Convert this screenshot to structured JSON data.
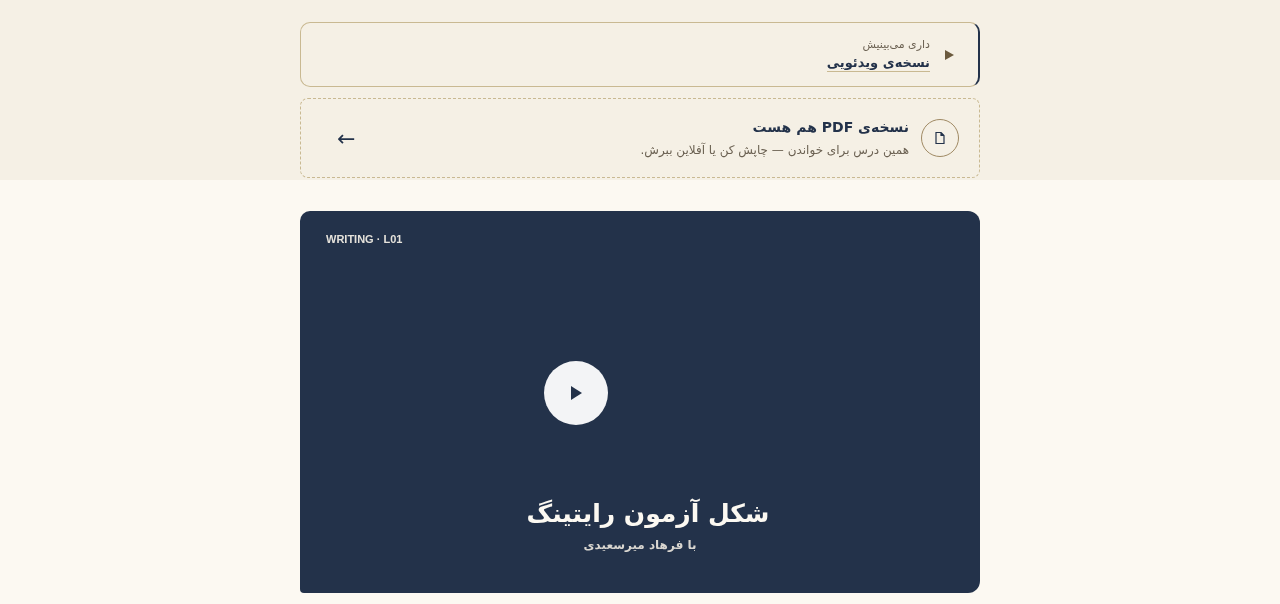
{
  "now_watching": {
    "caption": "داری می‌بینیش",
    "title": "نسخه‌ی ویدئویی",
    "selected": true
  },
  "pdf_offer": {
    "title": "نسخه‌ی PDF هم هست",
    "description": "همین درس برای خواندن — چاپش کن یا آفلاین ببرش.",
    "arrow": "←"
  },
  "video": {
    "tag": "WRITING · L01",
    "title": "شکل آزمون رایتینگ",
    "author": "با فرهاد میرسعیدی"
  }
}
